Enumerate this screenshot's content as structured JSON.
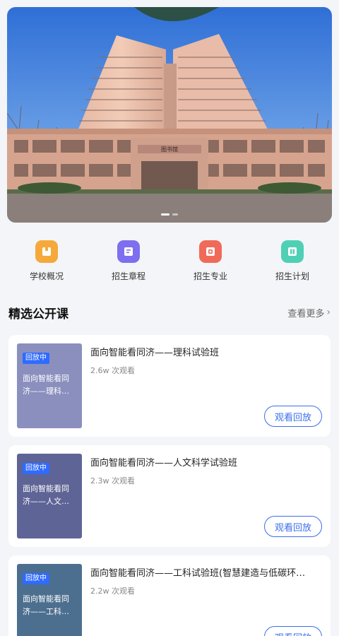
{
  "banner": {
    "building_sign": "图书馆",
    "slide_count": 3,
    "active_slide": 1
  },
  "nav": [
    {
      "label": "学校概况",
      "icon": "school-overview-icon",
      "color": "#f5a93b"
    },
    {
      "label": "招生章程",
      "icon": "admission-rules-icon",
      "color": "#7d6ff0"
    },
    {
      "label": "招生专业",
      "icon": "admission-majors-icon",
      "color": "#f06a5a"
    },
    {
      "label": "招生计划",
      "icon": "admission-plan-icon",
      "color": "#4fd0b5"
    }
  ],
  "section": {
    "title": "精选公开课",
    "more_label": "查看更多"
  },
  "courses": [
    {
      "badge": "回放中",
      "thumb_text": "面向智能看同济——理科…",
      "thumb_color": "#8a8fbe",
      "title": "面向智能看同济——理科试验班",
      "views": "2.6w 次观看",
      "button": "观看回放"
    },
    {
      "badge": "回放中",
      "thumb_text": "面向智能看同济——人文…",
      "thumb_color": "#5e6496",
      "title": "面向智能看同济——人文科学试验班",
      "views": "2.3w 次观看",
      "button": "观看回放"
    },
    {
      "badge": "回放中",
      "thumb_text": "面向智能看同济——工科…",
      "thumb_color": "#4d6f8f",
      "title": "面向智能看同济——工科试验班(智慧建造与低碳环…",
      "views": "2.2w 次观看",
      "button": "观看回放"
    }
  ]
}
